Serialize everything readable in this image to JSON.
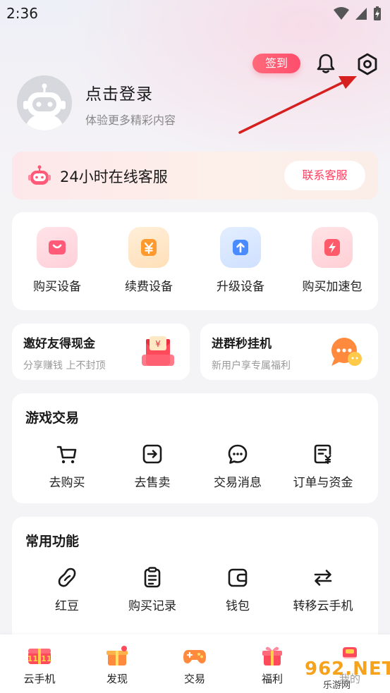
{
  "status_bar": {
    "time": "2:36"
  },
  "header": {
    "signin_label": "签到",
    "bell_icon": "bell-icon",
    "settings_icon": "gear-icon"
  },
  "profile": {
    "title": "点击登录",
    "subtitle": "体验更多精彩内容"
  },
  "service_banner": {
    "title": "24小时在线客服",
    "button_label": "联系客服"
  },
  "quick_actions": [
    {
      "label": "购买设备",
      "icon": "shopping-bag-icon",
      "color": "#ff5a78"
    },
    {
      "label": "续费设备",
      "icon": "yen-card-icon",
      "color": "#ff9a2e"
    },
    {
      "label": "升级设备",
      "icon": "upgrade-arrow-icon",
      "color": "#4a8cff"
    },
    {
      "label": "购买加速包",
      "icon": "lightning-icon",
      "color": "#ff5a6a"
    }
  ],
  "promos": [
    {
      "title": "邀好友得现金",
      "subtitle": "分享赚钱 上不封顶",
      "icon": "red-envelope-icon"
    },
    {
      "title": "进群秒挂机",
      "subtitle": "新用户享专属福利",
      "icon": "chat-bubble-icon"
    }
  ],
  "game_trade": {
    "title": "游戏交易",
    "items": [
      {
        "label": "去购买",
        "icon": "cart-icon"
      },
      {
        "label": "去售卖",
        "icon": "sell-arrow-icon"
      },
      {
        "label": "交易消息",
        "icon": "message-icon"
      },
      {
        "label": "订单与资金",
        "icon": "order-icon"
      }
    ]
  },
  "common_functions": {
    "title": "常用功能",
    "items": [
      {
        "label": "红豆",
        "icon": "bean-icon"
      },
      {
        "label": "购买记录",
        "icon": "clipboard-icon"
      },
      {
        "label": "钱包",
        "icon": "wallet-icon"
      },
      {
        "label": "转移云手机",
        "icon": "transfer-icon"
      }
    ]
  },
  "bottom_nav": [
    {
      "label": "云手机",
      "icon": "cloud-phone-icon"
    },
    {
      "label": "发现",
      "icon": "discover-icon"
    },
    {
      "label": "交易",
      "icon": "gamepad-icon"
    },
    {
      "label": "福利",
      "icon": "gift-icon"
    },
    {
      "label": "我的",
      "icon": "profile-icon"
    }
  ],
  "watermark": {
    "text": "962.NET",
    "sub": "乐游网"
  },
  "colors": {
    "accent": "#ff4d6d",
    "annotation_arrow": "#d62020"
  }
}
